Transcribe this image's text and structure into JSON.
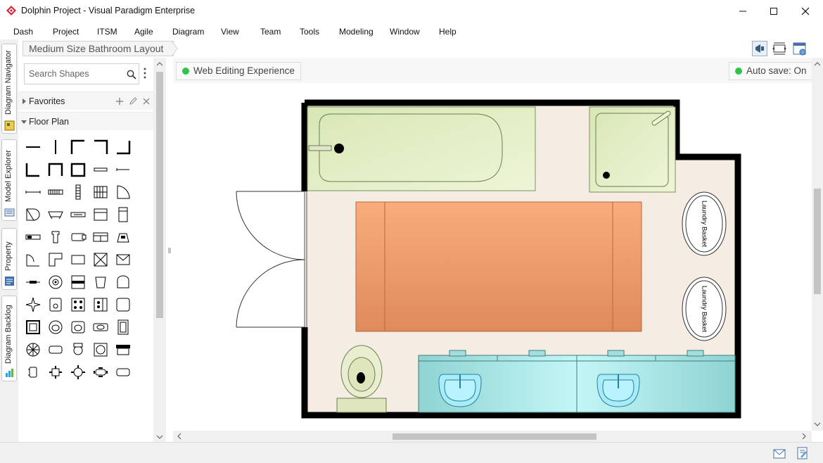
{
  "window": {
    "title": "Dolphin Project - Visual Paradigm Enterprise"
  },
  "menu": [
    "Dash",
    "Project",
    "ITSM",
    "Agile",
    "Diagram",
    "View",
    "Team",
    "Tools",
    "Modeling",
    "Window",
    "Help"
  ],
  "side_tabs": [
    "Diagram Navigator",
    "Model Explorer",
    "Property",
    "Diagram Backlog"
  ],
  "breadcrumb": {
    "diagram_name": "Medium Size Bathroom Layout"
  },
  "palette": {
    "search_placeholder": "Search Shapes",
    "favorites_label": "Favorites",
    "floor_plan_label": "Floor Plan",
    "shape_count": 55
  },
  "canvas": {
    "web_editing_label": "Web Editing Experience",
    "autosave_label": "Auto save: On",
    "autosave_dot_color": "#31c24a",
    "floor_plan": {
      "basket_labels": [
        "Laundry Basket",
        "Laundry Basket"
      ],
      "wall_color": "#000000",
      "floor_color": "#f5ede3",
      "bathtub_color": "#dceab8",
      "rug_color": "#f0a070",
      "vanity_color": "#9fe0e0"
    }
  }
}
